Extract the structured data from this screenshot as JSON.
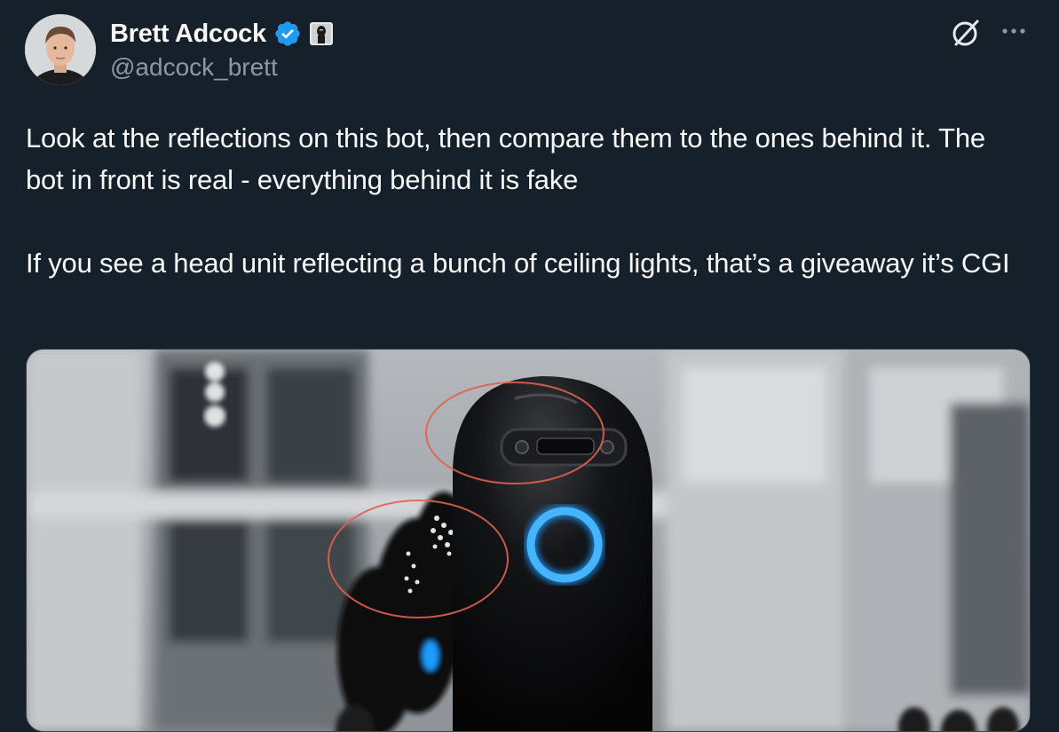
{
  "author": {
    "display_name": "Brett Adcock",
    "handle": "@adcock_brett",
    "verified": true,
    "badge_color": "#1d9bf0"
  },
  "icons": {
    "grok": "grok-icon",
    "more": "more-icon",
    "verified": "verified-badge-icon",
    "affiliation": "affiliation-badge-icon"
  },
  "tweet": {
    "paragraph_1": "Look at the reflections on this bot, then compare them to the ones behind it. The bot in front is real - everything behind it is fake",
    "paragraph_2": "If you see a head unit reflecting a bunch of ceiling lights, that’s a giveaway it’s CGI"
  },
  "colors": {
    "background": "#15202b",
    "text": "#f7f9f9",
    "secondary_text": "#8b98a5",
    "annotation_circle": "#e06050",
    "robot_light": "#1e9cff"
  }
}
